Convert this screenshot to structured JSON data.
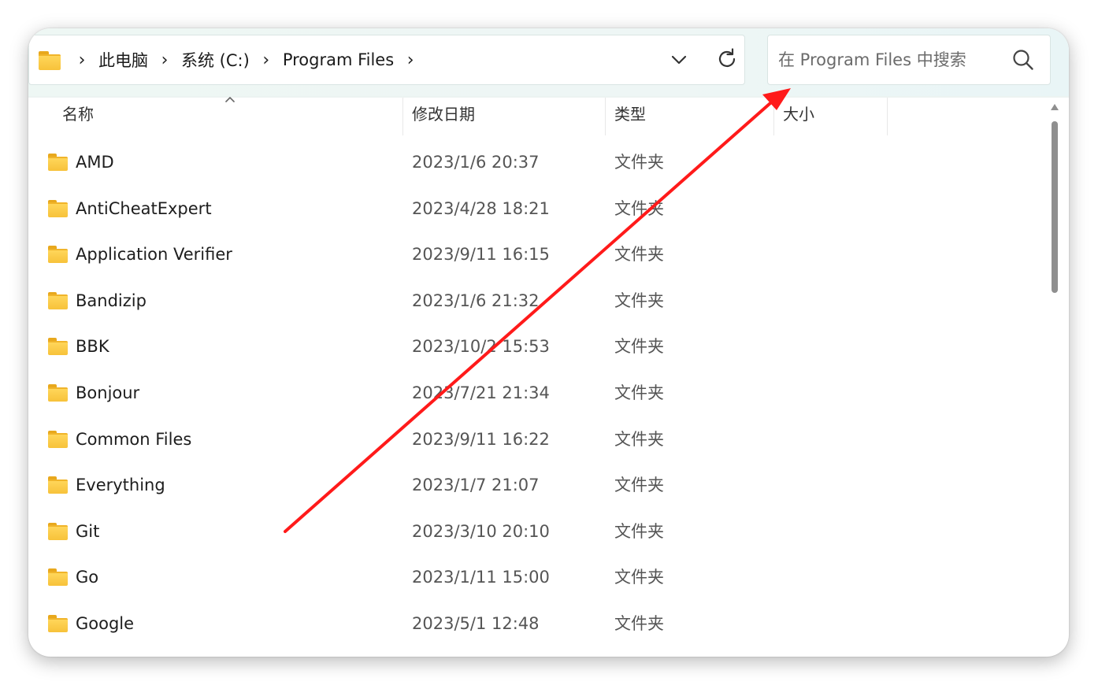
{
  "breadcrumb": {
    "items": [
      "此电脑",
      "系统 (C:)",
      "Program Files"
    ]
  },
  "search": {
    "placeholder": "在 Program Files 中搜索"
  },
  "columns": {
    "name": "名称",
    "date": "修改日期",
    "type": "类型",
    "size": "大小"
  },
  "files": [
    {
      "name": "AMD",
      "date": "2023/1/6 20:37",
      "type": "文件夹"
    },
    {
      "name": "AntiCheatExpert",
      "date": "2023/4/28 18:21",
      "type": "文件夹"
    },
    {
      "name": "Application Verifier",
      "date": "2023/9/11 16:15",
      "type": "文件夹"
    },
    {
      "name": "Bandizip",
      "date": "2023/1/6 21:32",
      "type": "文件夹"
    },
    {
      "name": "BBK",
      "date": "2023/10/2 15:53",
      "type": "文件夹"
    },
    {
      "name": "Bonjour",
      "date": "2023/7/21 21:34",
      "type": "文件夹"
    },
    {
      "name": "Common Files",
      "date": "2023/9/11 16:22",
      "type": "文件夹"
    },
    {
      "name": "Everything",
      "date": "2023/1/7 21:07",
      "type": "文件夹"
    },
    {
      "name": "Git",
      "date": "2023/3/10 20:10",
      "type": "文件夹"
    },
    {
      "name": "Go",
      "date": "2023/1/11 15:00",
      "type": "文件夹"
    },
    {
      "name": "Google",
      "date": "2023/5/1 12:48",
      "type": "文件夹"
    }
  ],
  "colors": {
    "folder": "#f7c23a",
    "annotation_arrow": "#ff1a1a",
    "toolbar_bg": "#eef7f4"
  },
  "icons": [
    "folder-icon",
    "chevron-right-icon",
    "chevron-down-icon",
    "refresh-icon",
    "search-icon",
    "sort-up-icon"
  ]
}
